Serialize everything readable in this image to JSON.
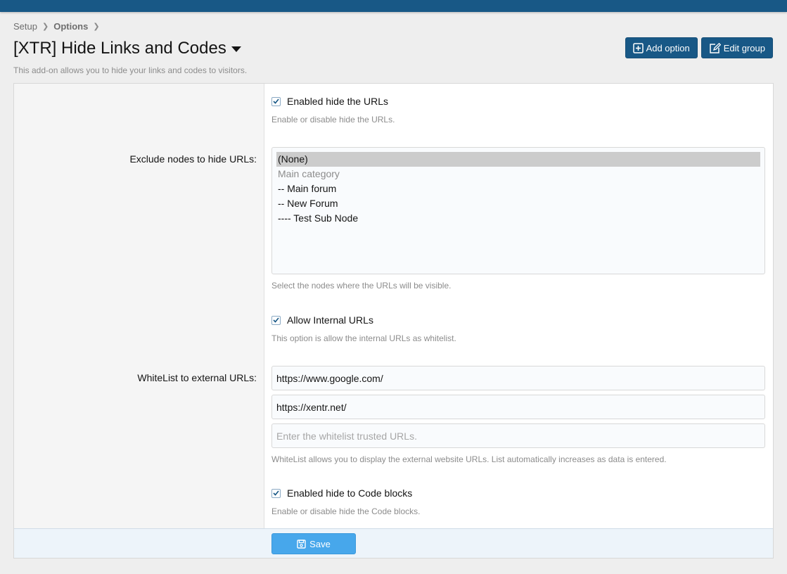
{
  "breadcrumb": {
    "item1": "Setup",
    "item2": "Options"
  },
  "header": {
    "title": "[XTR] Hide Links and Codes",
    "description": "This add-on allows you to hide your links and codes to visitors.",
    "add_option_label": "Add option",
    "edit_group_label": "Edit group"
  },
  "options": {
    "hide_urls": {
      "label": "Enabled hide the URLs",
      "hint": "Enable or disable hide the URLs.",
      "checked": true
    },
    "exclude_nodes": {
      "label": "Exclude nodes to hide URLs:",
      "nodes": [
        "(None)",
        "Main category",
        "-- Main forum",
        "-- New Forum",
        "---- Test Sub Node"
      ],
      "hint": "Select the nodes where the URLs will be visible."
    },
    "allow_internal": {
      "label": "Allow Internal URLs",
      "hint": "This option is allow the internal URLs as whitelist.",
      "checked": true
    },
    "whitelist": {
      "label": "WhiteList to external URLs:",
      "url1": "https://www.google.com/",
      "url2": "https://xentr.net/",
      "placeholder": "Enter the whitelist trusted URLs.",
      "hint": "WhiteList allows you to display the external website URLs. List automatically increases as data is entered."
    },
    "hide_code": {
      "label": "Enabled hide to Code blocks",
      "hint": "Enable or disable hide the Code blocks.",
      "checked": true
    }
  },
  "footer": {
    "save_label": "Save"
  },
  "colors": {
    "header_bar": "#185886",
    "primary_button": "#185886",
    "save_button": "#47a7eb"
  }
}
